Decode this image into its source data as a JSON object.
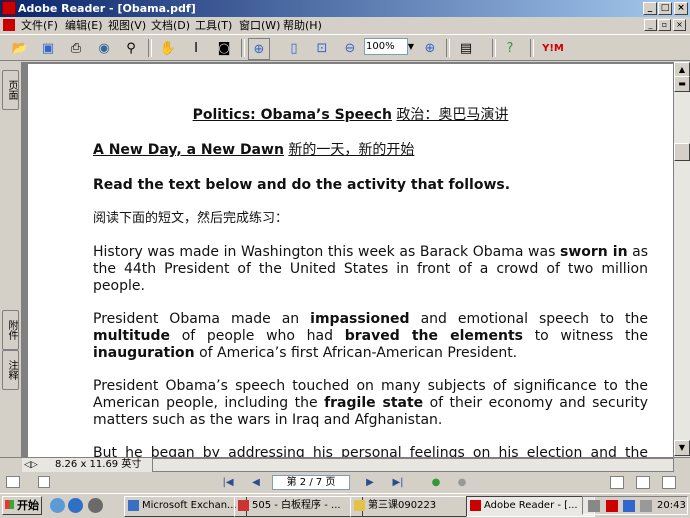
{
  "window": {
    "title": "Adobe Reader - [Obama.pdf]",
    "controls": {
      "minimize": "_",
      "maximize": "□",
      "close": "×"
    }
  },
  "menu": {
    "items": [
      "文件(F)",
      "编辑(E)",
      "视图(V)",
      "文档(D)",
      "工具(T)",
      "窗口(W)",
      "帮助(H)"
    ]
  },
  "toolbar": {
    "zoom": "100%",
    "icons": [
      "open-icon",
      "save-icon",
      "print-icon",
      "email-icon",
      "search-icon",
      "hand-tool-icon",
      "select-tool-icon",
      "snapshot-icon",
      "zoom-in-tool-icon",
      "actual-size-icon",
      "fit-page-icon",
      "zoom-out-icon",
      "zoom-in-icon",
      "page-layout-icon",
      "help-icon",
      "yahoo-icon"
    ],
    "yahoo_label": "Y!M"
  },
  "nav_panel": {
    "tab_pages": "页面",
    "tab_attachments": "附件",
    "tab_comments": "注释"
  },
  "document": {
    "title_en": "Politics: Obama’s Speech",
    "title_cn": "政治：奥巴马演讲",
    "subtitle_en": "A New Day, a New Dawn",
    "subtitle_cn": "新的一天，新的开始",
    "instruction": "Read the text below and do the activity that follows.",
    "instruction_cn": "阅读下面的短文，然后完成练习：",
    "p1_l1_a": "History was made in Washington this week as Barack Obama was",
    "p1_l1_b": "sworn in",
    "p1_l1_c": "as",
    "p1_l2": "the 44th President of the United States in front of a crowd of two million",
    "p1_l3": "people.",
    "p2_l1_a": "President Obama made an",
    "p2_l1_b": "impassioned",
    "p2_l1_c": "and emotional speech to the",
    "p2_l2_a": "multitude",
    "p2_l2_b": "of people who had",
    "p2_l2_c": "braved the elements",
    "p2_l2_d": "to witness the",
    "p2_l3_a": "inauguration",
    "p2_l3_b": "of America’s first African-American President.",
    "p3_l1": "President Obama’s speech touched on many subjects of significance to the",
    "p3_l2_a": "American people, including the",
    "p3_l2_b": "fragile state",
    "p3_l2_c": "of their economy and security",
    "p3_l3": "matters such as the wars in Iraq and Afghanistan.",
    "p4_l1": "But he began by addressing his personal feelings on his election and the"
  },
  "status": {
    "page_size": "8.26 x 11.69 英寸"
  },
  "navigation": {
    "page_indicator": "第 2 / 7 页"
  },
  "taskbar": {
    "start_label": "开始",
    "tasks": [
      "Microsoft Exchan...",
      "505 - 白板程序 - ...",
      "第三课090223",
      "Adobe Reader - [..."
    ],
    "clock": "20:43"
  },
  "colors": {
    "titlebar_start": "#0a246a",
    "titlebar_end": "#a6caf0",
    "chrome": "#d4d0c8",
    "page": "#ffffff"
  }
}
